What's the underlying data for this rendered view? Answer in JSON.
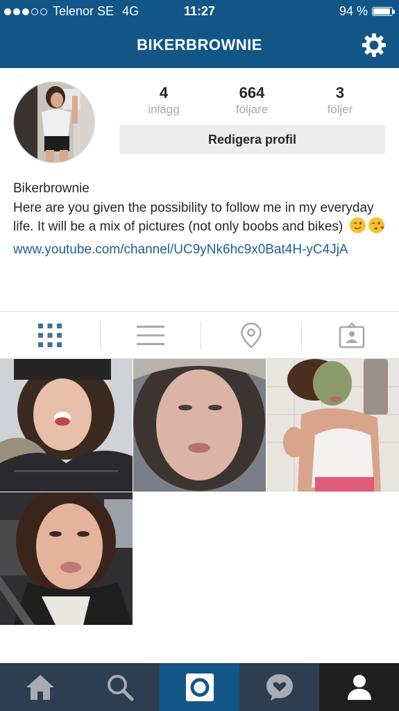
{
  "status_bar": {
    "carrier": "Telenor SE",
    "network": "4G",
    "time": "11:27",
    "battery": "94 %",
    "battery_level": 0.94,
    "signal_bars": 3
  },
  "header": {
    "title": "BIKERBROWNIE",
    "settings_icon": "gear-icon"
  },
  "profile": {
    "stats": [
      {
        "value": "4",
        "label": "inlägg"
      },
      {
        "value": "664",
        "label": "följare"
      },
      {
        "value": "3",
        "label": "följer"
      }
    ],
    "edit_button": "Redigera profil",
    "name": "Bikerbrownie",
    "bio": "Here are you given the possibility to follow me in my everyday life. It will be a mix of pictures (not only boobs and bikes)",
    "bio_emojis": [
      "wink-emoji",
      "kiss-emoji"
    ],
    "link": "www.youtube.com/channel/UC9yNk6hc9x0Bat4H-yC4JjA"
  },
  "view_tabs": [
    {
      "icon": "grid-icon",
      "active": true
    },
    {
      "icon": "list-icon",
      "active": false
    },
    {
      "icon": "location-pin-icon",
      "active": false
    },
    {
      "icon": "tagged-photos-icon",
      "active": false
    }
  ],
  "photos": [
    {
      "icon": "photo-selfie-fur-hood"
    },
    {
      "icon": "photo-selfie-hood-close"
    },
    {
      "icon": "photo-selfie-face-mask"
    },
    {
      "icon": "photo-selfie-car"
    }
  ],
  "bottom_nav": [
    {
      "icon": "home-icon"
    },
    {
      "icon": "search-icon"
    },
    {
      "icon": "camera-icon",
      "active": true
    },
    {
      "icon": "activity-heart-icon"
    },
    {
      "icon": "profile-icon"
    }
  ],
  "colors": {
    "header_blue": "#125688",
    "link_blue": "#1f5e8e",
    "active_tab_blue": "#3f729b",
    "bottom_nav": "#2c3e50"
  }
}
